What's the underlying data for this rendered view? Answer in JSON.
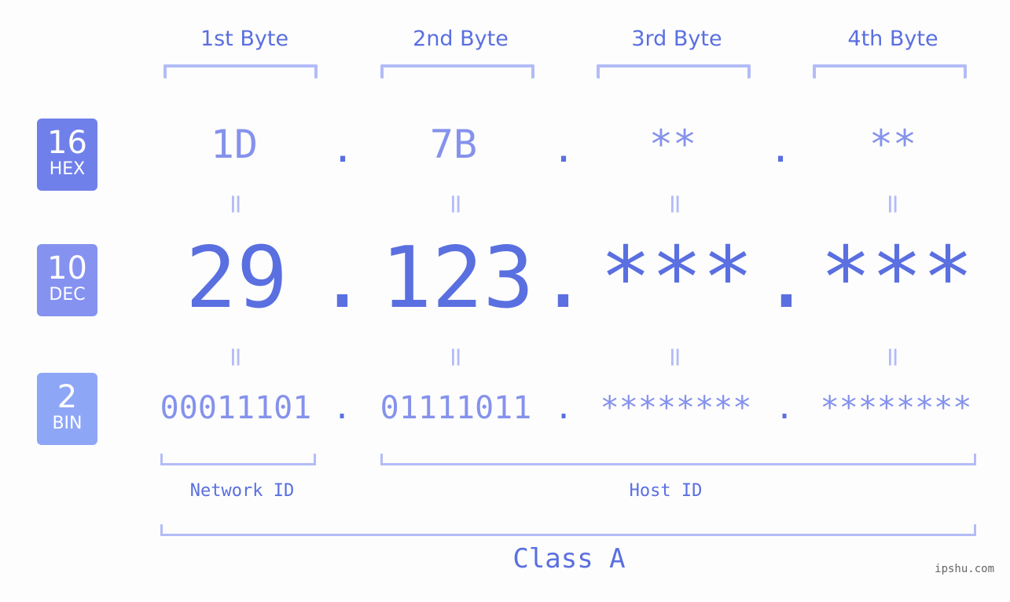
{
  "bytes": [
    {
      "label": "1st Byte",
      "hex": "1D",
      "dec": "29",
      "bin": "00011101"
    },
    {
      "label": "2nd Byte",
      "hex": "7B",
      "dec": "123",
      "bin": "01111011"
    },
    {
      "label": "3rd Byte",
      "hex": "**",
      "dec": "***",
      "bin": "********"
    },
    {
      "label": "4th Byte",
      "hex": "**",
      "dec": "***",
      "bin": "********"
    }
  ],
  "separator": ".",
  "equals": "=",
  "badges": {
    "hex": {
      "num": "16",
      "label": "HEX",
      "color": "#7080ea"
    },
    "dec": {
      "num": "10",
      "label": "DEC",
      "color": "#8592f0"
    },
    "bin": {
      "num": "2",
      "label": "BIN",
      "color": "#8ea6f6"
    }
  },
  "network_id_label": "Network ID",
  "host_id_label": "Host ID",
  "class_label": "Class A",
  "watermark": "ipshu.com"
}
